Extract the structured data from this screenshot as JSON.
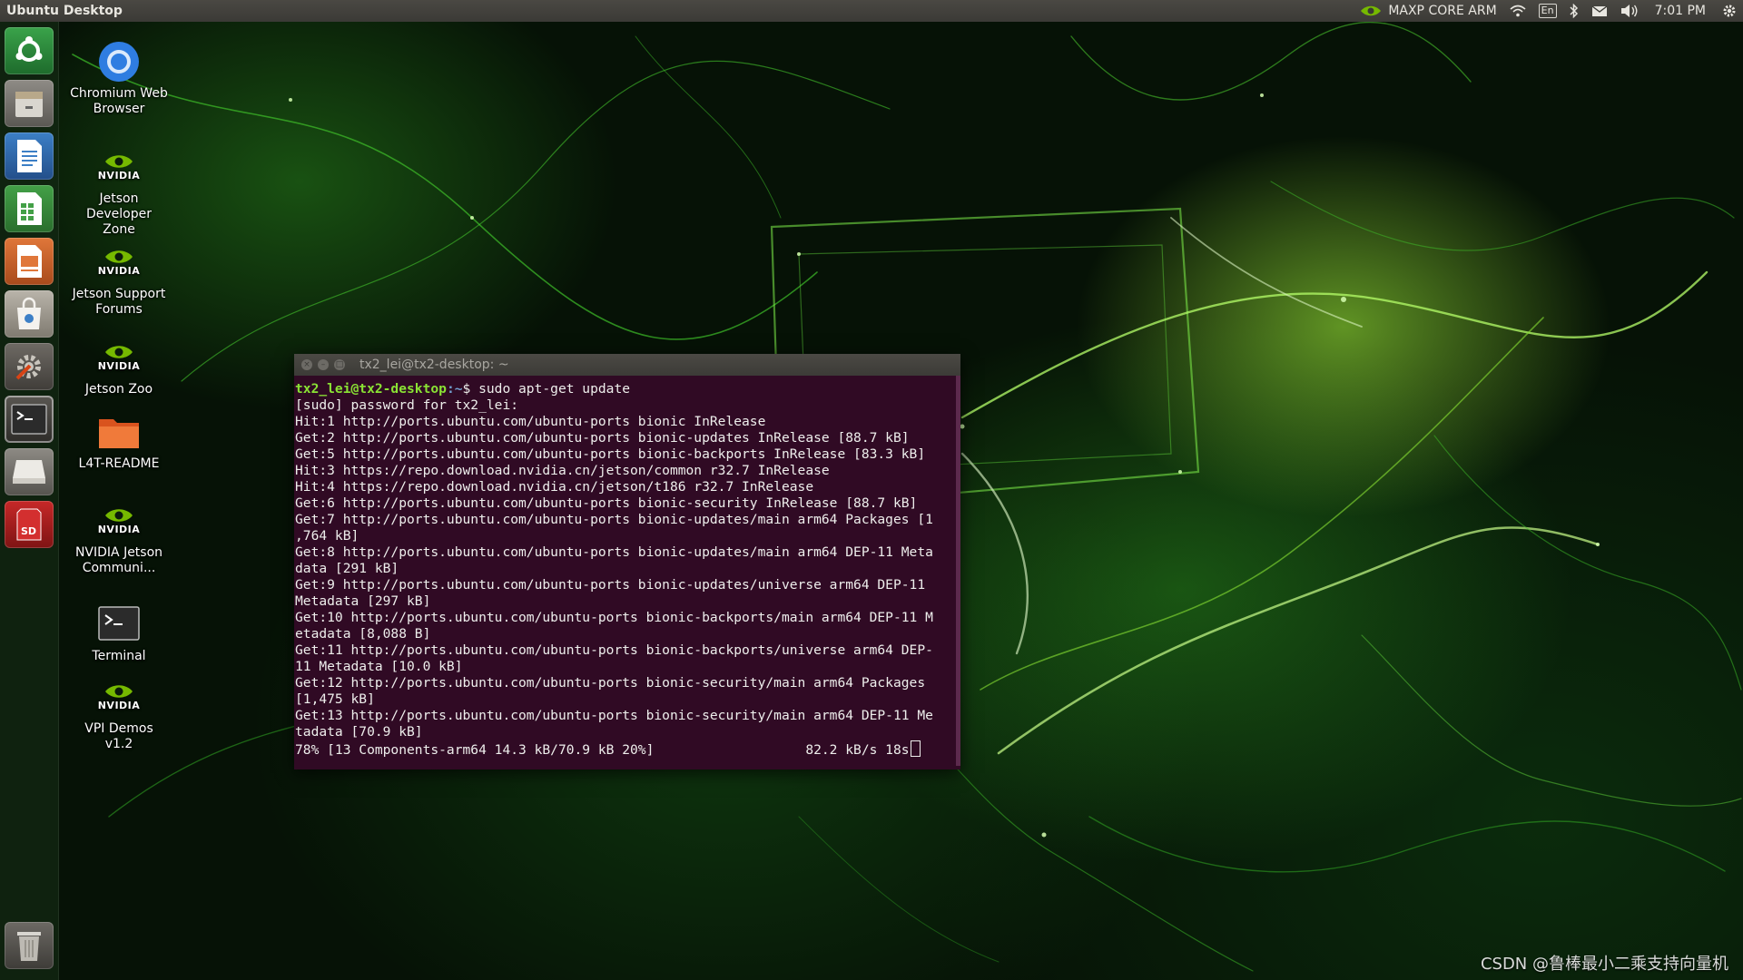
{
  "top_panel": {
    "title": "Ubuntu Desktop",
    "power_mode": "MAXP CORE ARM",
    "language": "En",
    "time": "7:01 PM"
  },
  "launcher": {
    "items": [
      {
        "name": "ubuntu-dash",
        "icon": "ubuntu-logo-icon"
      },
      {
        "name": "files",
        "icon": "file-cabinet-icon"
      },
      {
        "name": "libreoffice-writer",
        "icon": "writer-icon"
      },
      {
        "name": "libreoffice-calc",
        "icon": "calc-icon"
      },
      {
        "name": "libreoffice-impress",
        "icon": "impress-icon"
      },
      {
        "name": "software-center",
        "icon": "shopping-bag-icon"
      },
      {
        "name": "system-settings",
        "icon": "settings-icon"
      },
      {
        "name": "terminal",
        "icon": "terminal-icon"
      },
      {
        "name": "drive",
        "icon": "drive-icon"
      },
      {
        "name": "sd-card",
        "icon": "sd-card-icon"
      },
      {
        "name": "trash",
        "icon": "trash-icon"
      }
    ]
  },
  "desktop": {
    "icons": [
      {
        "label": "Chromium Web Browser",
        "icon": "chromium-icon"
      },
      {
        "label": "Jetson Developer Zone",
        "icon": "nvidia-icon"
      },
      {
        "label": "Jetson Support Forums",
        "icon": "nvidia-icon"
      },
      {
        "label": "Jetson Zoo",
        "icon": "nvidia-icon"
      },
      {
        "label": "L4T-README",
        "icon": "folder-icon"
      },
      {
        "label": "NVIDIA Jetson Communi...",
        "icon": "nvidia-icon"
      },
      {
        "label": "Terminal",
        "icon": "terminal-icon"
      },
      {
        "label": "VPI Demos v1.2",
        "icon": "nvidia-icon"
      }
    ],
    "nvidia_word": "NVIDIA"
  },
  "terminal": {
    "title": "tx2_lei@tx2-desktop: ~",
    "prompt_user": "tx2_lei@tx2-desktop",
    "prompt_path": ":~",
    "command": "$ sudo apt-get update",
    "lines": [
      "[sudo] password for tx2_lei:",
      "Hit:1 http://ports.ubuntu.com/ubuntu-ports bionic InRelease",
      "Get:2 http://ports.ubuntu.com/ubuntu-ports bionic-updates InRelease [88.7 kB]",
      "Get:5 http://ports.ubuntu.com/ubuntu-ports bionic-backports InRelease [83.3 kB]",
      "Hit:3 https://repo.download.nvidia.cn/jetson/common r32.7 InRelease",
      "Hit:4 https://repo.download.nvidia.cn/jetson/t186 r32.7 InRelease",
      "Get:6 http://ports.ubuntu.com/ubuntu-ports bionic-security InRelease [88.7 kB]",
      "Get:7 http://ports.ubuntu.com/ubuntu-ports bionic-updates/main arm64 Packages [1",
      ",764 kB]",
      "Get:8 http://ports.ubuntu.com/ubuntu-ports bionic-updates/main arm64 DEP-11 Meta",
      "data [291 kB]",
      "Get:9 http://ports.ubuntu.com/ubuntu-ports bionic-updates/universe arm64 DEP-11",
      "Metadata [297 kB]",
      "Get:10 http://ports.ubuntu.com/ubuntu-ports bionic-backports/main arm64 DEP-11 M",
      "etadata [8,088 B]",
      "Get:11 http://ports.ubuntu.com/ubuntu-ports bionic-backports/universe arm64 DEP-",
      "11 Metadata [10.0 kB]",
      "Get:12 http://ports.ubuntu.com/ubuntu-ports bionic-security/main arm64 Packages",
      "[1,475 kB]",
      "Get:13 http://ports.ubuntu.com/ubuntu-ports bionic-security/main arm64 DEP-11 Me",
      "tadata [70.9 kB]"
    ],
    "progress_line": "78% [13 Components-arm64 14.3 kB/70.9 kB 20%]                   82.2 kB/s 18s"
  },
  "watermark": "CSDN @鲁棒最小二乘支持向量机",
  "colors": {
    "terminal_bg": "#300a24",
    "prompt_user": "#8ae234",
    "prompt_path": "#729fcf",
    "accent_green": "#76b900"
  }
}
